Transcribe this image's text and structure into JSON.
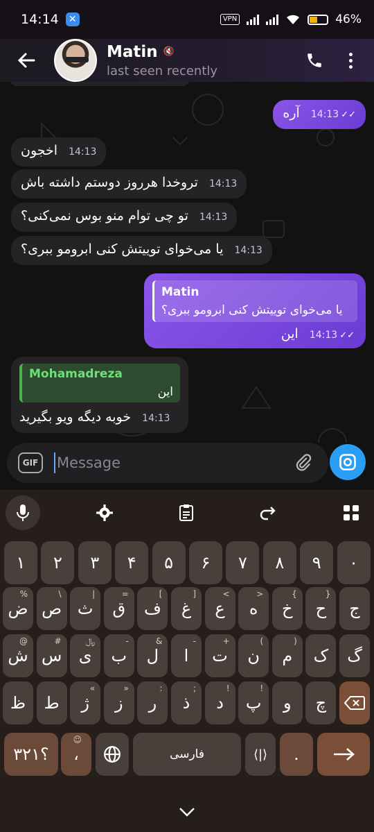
{
  "status": {
    "time": "14:14",
    "vpn": "VPN",
    "battery": "46%"
  },
  "header": {
    "name": "Matin",
    "last_seen": "last seen recently"
  },
  "messages": [
    {
      "dir": "out",
      "text": "آره",
      "time": "14:13"
    },
    {
      "dir": "in",
      "text": "اخجون",
      "time": "14:13"
    },
    {
      "dir": "in",
      "text": "تروخدا هرروز دوستم داشته باش",
      "time": "14:13"
    },
    {
      "dir": "in",
      "text": "تو چی توام منو بوس نمی‌کنی؟",
      "time": "14:13"
    },
    {
      "dir": "in",
      "text": "یا می‌خوای توییتش کنی ابرومو ببری؟",
      "time": "14:13"
    },
    {
      "dir": "out",
      "reply_name": "Matin",
      "reply_text": "یا می‌خوای توییتش کنی ابرومو ببری؟",
      "text": "این",
      "time": "14:13"
    },
    {
      "dir": "in",
      "reply_name": "Mohamadreza",
      "reply_text": "این",
      "text": "خوبه دیگه ویو بگیرید",
      "time": "14:13"
    }
  ],
  "input": {
    "placeholder": "Message",
    "gif_label": "GIF"
  },
  "keyboard": {
    "row1": [
      "۱",
      "۲",
      "۳",
      "۴",
      "۵",
      "۶",
      "۷",
      "۸",
      "۹",
      "۰"
    ],
    "row2": [
      {
        "k": "ض",
        "h": "%"
      },
      {
        "k": "ص",
        "h": "\\"
      },
      {
        "k": "ث",
        "h": "|"
      },
      {
        "k": "ق",
        "h": "="
      },
      {
        "k": "ف",
        "h": "["
      },
      {
        "k": "غ",
        "h": "]"
      },
      {
        "k": "ع",
        "h": "<"
      },
      {
        "k": "ه",
        "h": ">"
      },
      {
        "k": "خ",
        "h": "{"
      },
      {
        "k": "ح",
        "h": "}"
      },
      {
        "k": "ج",
        "h": ""
      }
    ],
    "row3": [
      {
        "k": "ش",
        "h": "@"
      },
      {
        "k": "س",
        "h": "#"
      },
      {
        "k": "ی",
        "h": "﷼"
      },
      {
        "k": "ب",
        "h": "-"
      },
      {
        "k": "ل",
        "h": "&"
      },
      {
        "k": "ا",
        "h": "-"
      },
      {
        "k": "ت",
        "h": "+"
      },
      {
        "k": "ن",
        "h": "("
      },
      {
        "k": "م",
        "h": ")"
      },
      {
        "k": "ک",
        "h": ""
      },
      {
        "k": "گ",
        "h": ""
      }
    ],
    "row4": [
      {
        "k": "ظ",
        "h": ""
      },
      {
        "k": "ط",
        "h": ""
      },
      {
        "k": "ژ",
        "h": "«"
      },
      {
        "k": "ز",
        "h": "»"
      },
      {
        "k": "ر",
        "h": ":"
      },
      {
        "k": "ذ",
        "h": ";"
      },
      {
        "k": "د",
        "h": "!"
      },
      {
        "k": "پ",
        "h": "!"
      },
      {
        "k": "و",
        "h": ""
      },
      {
        "k": "چ",
        "h": ""
      }
    ],
    "sym_label": "؟۳۲۱",
    "comma": "،",
    "space_label": "فارسی",
    "period": "."
  }
}
